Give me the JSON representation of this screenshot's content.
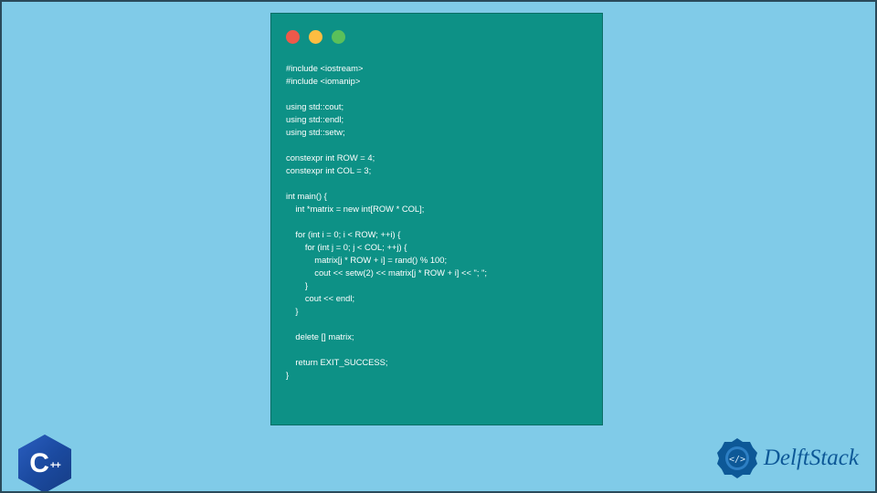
{
  "code_lines": "#include <iostream>\n#include <iomanip>\n\nusing std::cout;\nusing std::endl;\nusing std::setw;\n\nconstexpr int ROW = 4;\nconstexpr int COL = 3;\n\nint main() {\n    int *matrix = new int[ROW * COL];\n\n    for (int i = 0; i < ROW; ++i) {\n        for (int j = 0; j < COL; ++j) {\n            matrix[j * ROW + i] = rand() % 100;\n            cout << setw(2) << matrix[j * ROW + i] << \"; \";\n        }\n        cout << endl;\n    }\n\n    delete [] matrix;\n\n    return EXIT_SUCCESS;\n}",
  "cpp_label_c": "C",
  "cpp_label_plus": "++",
  "brand_name": "DelftStack"
}
